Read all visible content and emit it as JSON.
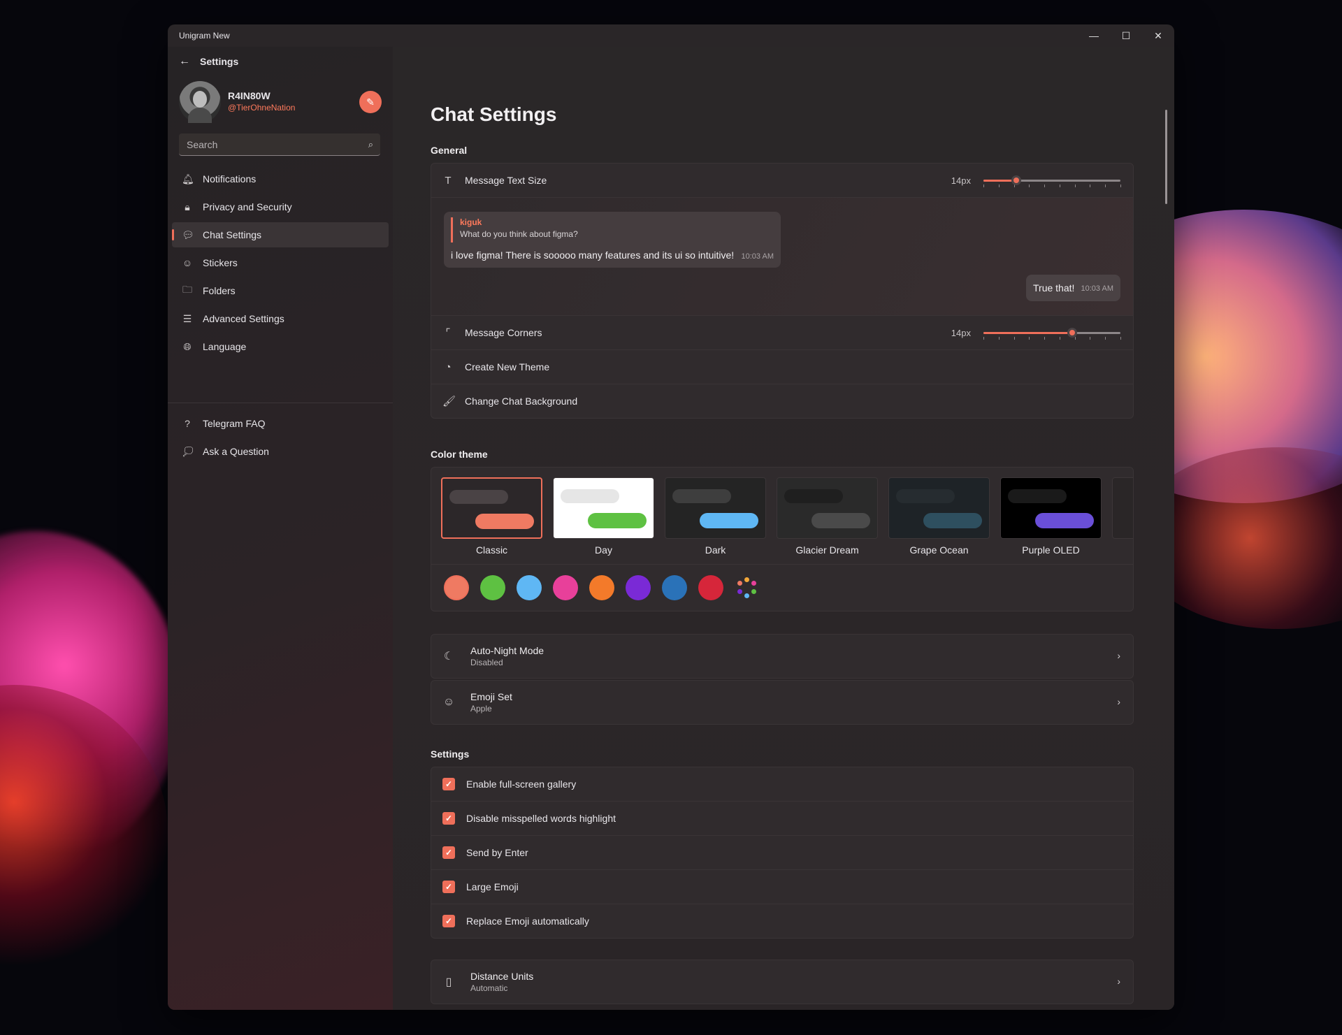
{
  "window": {
    "title": "Unigram New"
  },
  "controls": {
    "minimize": "—",
    "maximize": "☐",
    "close": "✕"
  },
  "sidebar": {
    "header": "Settings",
    "profile": {
      "name": "R4IN80W",
      "handle": "@TierOhneNation"
    },
    "search": {
      "placeholder": "Search"
    },
    "items": [
      {
        "label": "Notifications",
        "icon": "bell-icon",
        "glyph": "🔔︎"
      },
      {
        "label": "Privacy and Security",
        "icon": "lock-icon",
        "glyph": "🔒︎"
      },
      {
        "label": "Chat Settings",
        "icon": "chat-icon",
        "glyph": "💬︎",
        "active": true
      },
      {
        "label": "Stickers",
        "icon": "sticker-icon",
        "glyph": "☺"
      },
      {
        "label": "Folders",
        "icon": "folder-icon",
        "glyph": "🗀"
      },
      {
        "label": "Advanced Settings",
        "icon": "sliders-icon",
        "glyph": "☰"
      },
      {
        "label": "Language",
        "icon": "globe-icon",
        "glyph": "🌐︎"
      }
    ],
    "items2": [
      {
        "label": "Telegram FAQ",
        "icon": "help-icon",
        "glyph": "?"
      },
      {
        "label": "Ask a Question",
        "icon": "question-chat-icon",
        "glyph": "💭︎"
      }
    ]
  },
  "main": {
    "title": "Chat Settings",
    "general": {
      "label": "General",
      "text_size": {
        "label": "Message Text Size",
        "value": "14px",
        "level": 0.24
      },
      "preview": {
        "reply_name": "kiguk",
        "reply_text": "What do you think about figma?",
        "incoming": "i love figma! There is sooooo many features and its ui so intuitive!",
        "incoming_time": "10:03 AM",
        "outgoing": "True that!",
        "outgoing_time": "10:03 AM"
      },
      "corners": {
        "label": "Message Corners",
        "value": "14px",
        "level": 0.65
      },
      "create_theme": "Create New Theme",
      "change_bg": "Change Chat Background"
    },
    "color_theme": {
      "label": "Color theme",
      "themes": [
        {
          "name": "Classic",
          "bg": "#2c2729",
          "in": "#4a4345",
          "out": "#ef7a62",
          "selected": true
        },
        {
          "name": "Day",
          "bg": "#ffffff",
          "in": "#e6e6e6",
          "out": "#5ec142"
        },
        {
          "name": "Dark",
          "bg": "#242424",
          "in": "#3e3e3e",
          "out": "#5fb7f4"
        },
        {
          "name": "Glacier Dream",
          "bg": "#2a2a2a",
          "in": "#1f1f1f",
          "out": "#4a4a4a"
        },
        {
          "name": "Grape Ocean",
          "bg": "#1e2327",
          "in": "#262c30",
          "out": "#2e4f5f"
        },
        {
          "name": "Purple OLED",
          "bg": "#000000",
          "in": "#1a1a1a",
          "out": "#6a4fd8"
        }
      ],
      "accents": [
        "#ef7a62",
        "#5ec142",
        "#5fb7f4",
        "#e8409a",
        "#f37a2a",
        "#7a2ad6",
        "#2a72b8",
        "#d6263a"
      ],
      "multi_colors": [
        "#f3a83a",
        "#e8409a",
        "#5ec142",
        "#5fb7f4",
        "#7a2ad6",
        "#ef7a62"
      ]
    },
    "auto_night": {
      "label": "Auto-Night Mode",
      "value": "Disabled"
    },
    "emoji_set": {
      "label": "Emoji Set",
      "value": "Apple"
    },
    "settings": {
      "label": "Settings",
      "checks": [
        {
          "label": "Enable full-screen gallery",
          "checked": true
        },
        {
          "label": "Disable misspelled words highlight",
          "checked": true
        },
        {
          "label": "Send by Enter",
          "checked": true
        },
        {
          "label": "Large Emoji",
          "checked": true
        },
        {
          "label": "Replace Emoji automatically",
          "checked": true
        }
      ]
    },
    "distance": {
      "label": "Distance Units",
      "value": "Automatic"
    }
  }
}
